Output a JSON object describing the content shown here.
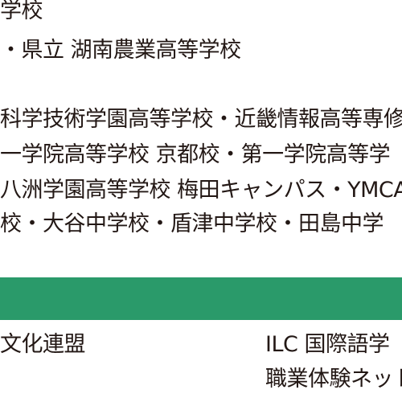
{
  "lines": [
    "学校",
    "・県立 湖南農業高等学校",
    "科学技術学園高等学校・近畿情報高等専修",
    "一学院高等学校 京都校・第一学院高等学",
    "八洲学園高等学校 梅田キャンパス・YMCA",
    "校・大谷中学校・盾津中学校・田島中学"
  ],
  "band_color": "#2a9a6a",
  "bottom": {
    "left": "文化連盟",
    "right_1": "ILC 国際語学",
    "right_2": "職業体験ネット"
  }
}
